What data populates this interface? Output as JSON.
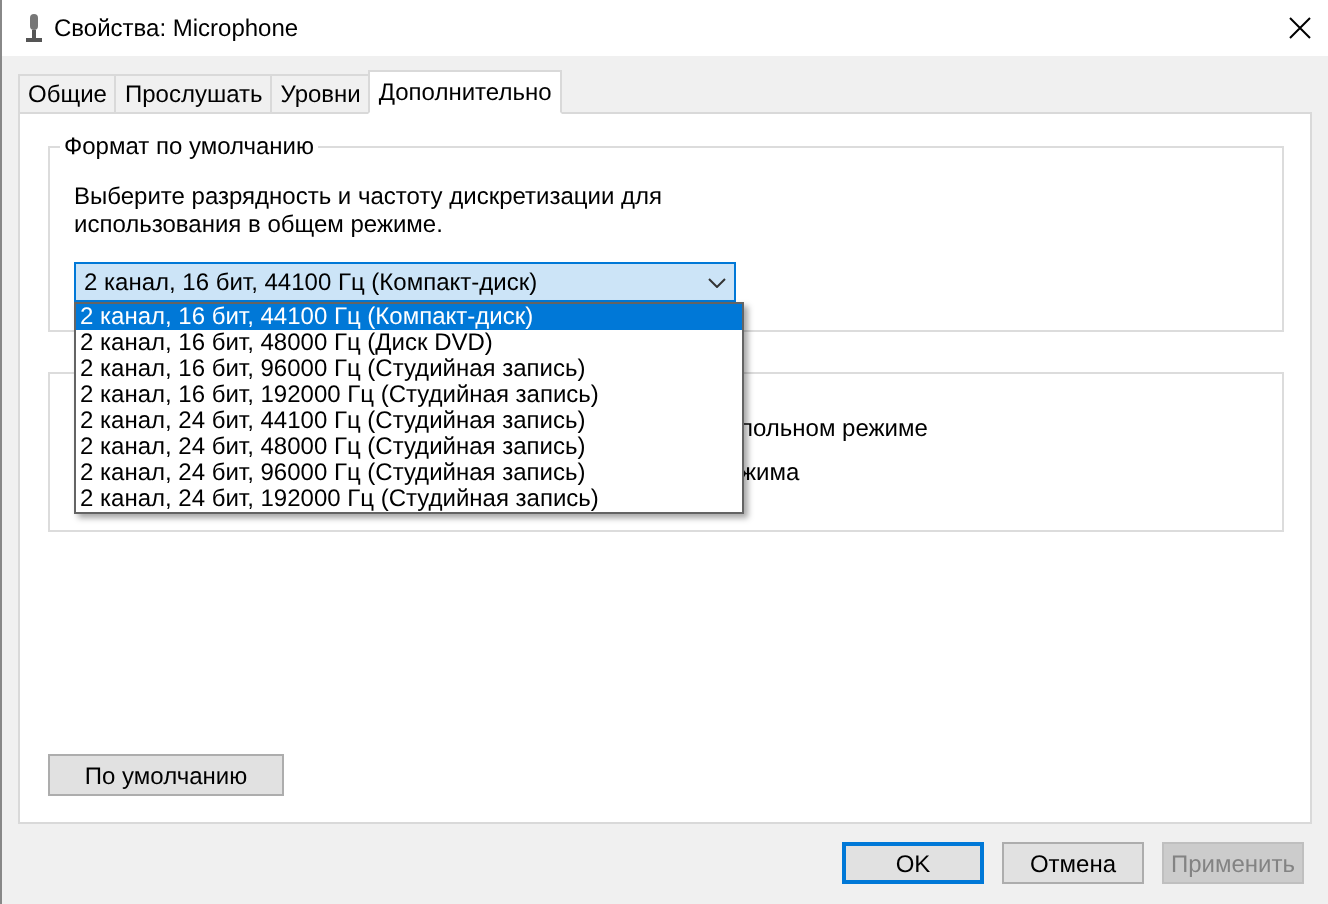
{
  "window": {
    "title": "Свойства: Microphone"
  },
  "tabs": [
    {
      "label": "Общие",
      "selected": false
    },
    {
      "label": "Прослушать",
      "selected": false
    },
    {
      "label": "Уровни",
      "selected": false
    },
    {
      "label": "Дополнительно",
      "selected": true
    }
  ],
  "default_format": {
    "title": "Формат по умолчанию",
    "description": "Выберите разрядность и частоту дискретизации для использования в общем режиме.",
    "combo": {
      "value": "2 канал, 16 бит, 44100 Гц (Компакт-диск)",
      "expanded": true
    },
    "options": [
      {
        "label": "2 канал, 16 бит, 44100 Гц (Компакт-диск)",
        "selected": true
      },
      {
        "label": "2 канал, 16 бит, 48000 Гц (Диск DVD)",
        "selected": false
      },
      {
        "label": "2 канал, 16 бит, 96000 Гц (Студийная запись)",
        "selected": false
      },
      {
        "label": "2 канал, 16 бит, 192000 Гц (Студийная запись)",
        "selected": false
      },
      {
        "label": "2 канал, 24 бит, 44100 Гц (Студийная запись)",
        "selected": false
      },
      {
        "label": "2 канал, 24 бит, 48000 Гц (Студийная запись)",
        "selected": false
      },
      {
        "label": "2 канал, 24 бит, 96000 Гц (Студийная запись)",
        "selected": false
      },
      {
        "label": "2 канал, 24 бит, 192000 Гц (Студийная запись)",
        "selected": false
      }
    ]
  },
  "exclusive_mode": {
    "lines": [
      "польном режиме",
      "жима"
    ]
  },
  "restore_button": "По умолчанию",
  "buttons": [
    {
      "label": "OK",
      "default": true,
      "disabled": false
    },
    {
      "label": "Отмена",
      "default": false,
      "disabled": false
    },
    {
      "label": "Применить",
      "default": false,
      "disabled": true
    }
  ]
}
